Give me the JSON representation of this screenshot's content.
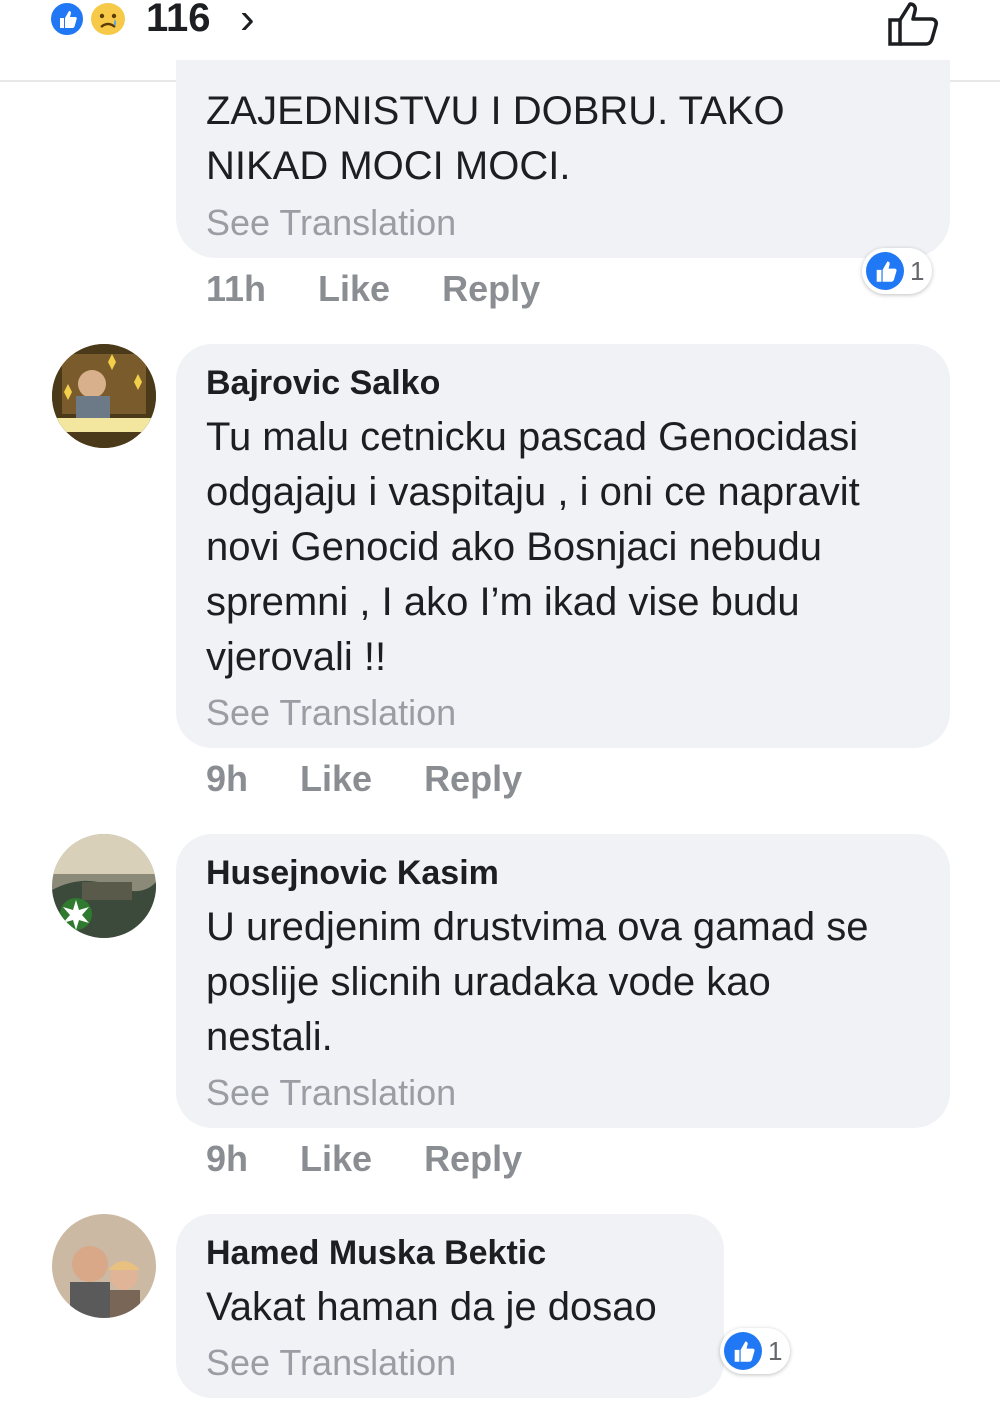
{
  "header": {
    "reaction_count": "116",
    "chevron": "›",
    "icons": [
      "like-reaction-icon",
      "sad-reaction-icon",
      "thumbs-up-outline-icon"
    ],
    "like_color": "#2078f4"
  },
  "comments": [
    {
      "author": "",
      "text": "ZAJEDNISTVU  I DOBRU. TAKO\nNIKAD MOCI MOCI.",
      "see_translation": "See Translation",
      "time": "11h",
      "like": "Like",
      "reply": "Reply",
      "reactions": "1"
    },
    {
      "author": "Bajrovic Salko",
      "text": "Tu malu cetnicku pascad Genocidasi\nodgajaju  i vaspitaju , i oni ce napravit\nnovi Genocid ako  Bosnjaci nebudu\nspremni , I ako I’m ikad vise budu\nvjerovali !!",
      "see_translation": "See Translation",
      "time": "9h",
      "like": "Like",
      "reply": "Reply"
    },
    {
      "author": "Husejnovic Kasim",
      "text": "U uredjenim drustvima ova gamad se\nposlije slicnih uradaka vode kao\nnestali.",
      "see_translation": "See Translation",
      "time": "9h",
      "like": "Like",
      "reply": "Reply"
    },
    {
      "author": "Hamed Muska Bektic",
      "text": "Vakat haman da je dosao",
      "see_translation": "See Translation",
      "reactions": "1"
    }
  ]
}
